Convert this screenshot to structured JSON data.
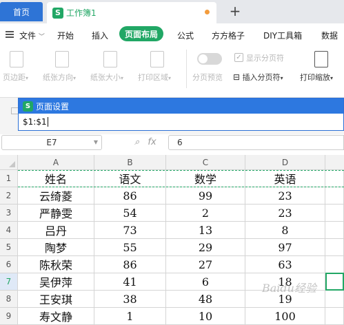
{
  "tabs": {
    "home": "首页",
    "doc": "工作簿1",
    "add": "+"
  },
  "menu": {
    "file": "文件",
    "items": [
      "开始",
      "插入",
      "页面布局",
      "公式",
      "方方格子",
      "DIY工具箱",
      "数据"
    ],
    "active": "页面布局"
  },
  "ribbon": {
    "margin": "页边距",
    "orientation": "纸张方向",
    "size": "纸张大小",
    "print_area": "打印区域",
    "page_preview": "分页预览",
    "show_breaks": "显示分页符",
    "insert_break": "插入分页符",
    "print_scale": "打印缩放"
  },
  "dialog": {
    "title": "页面设置",
    "value": "$1:$1"
  },
  "formula": {
    "cell_ref": "E7",
    "fx": "fx",
    "value": "6"
  },
  "sheet": {
    "columns": [
      "A",
      "B",
      "C",
      "D"
    ],
    "rows": [
      {
        "num": "1",
        "cells": [
          "姓名",
          "语文",
          "数学",
          "英语"
        ]
      },
      {
        "num": "2",
        "cells": [
          "云绮菱",
          "86",
          "99",
          "23"
        ]
      },
      {
        "num": "3",
        "cells": [
          "严静雯",
          "54",
          "2",
          "23"
        ]
      },
      {
        "num": "4",
        "cells": [
          "吕丹",
          "73",
          "13",
          "8"
        ]
      },
      {
        "num": "5",
        "cells": [
          "陶梦",
          "55",
          "29",
          "97"
        ]
      },
      {
        "num": "6",
        "cells": [
          "陈秋荣",
          "86",
          "27",
          "63"
        ]
      },
      {
        "num": "7",
        "cells": [
          "吴伊萍",
          "41",
          "6",
          "18"
        ]
      },
      {
        "num": "8",
        "cells": [
          "王安琪",
          "38",
          "48",
          "19"
        ]
      },
      {
        "num": "9",
        "cells": [
          "寿文静",
          "1",
          "10",
          "100"
        ]
      }
    ],
    "active_row": "7"
  },
  "watermark": "Baidu经验",
  "colors": {
    "accent": "#21a765",
    "home_tab": "#2e74d6",
    "dialog_title": "#2d78e0"
  }
}
